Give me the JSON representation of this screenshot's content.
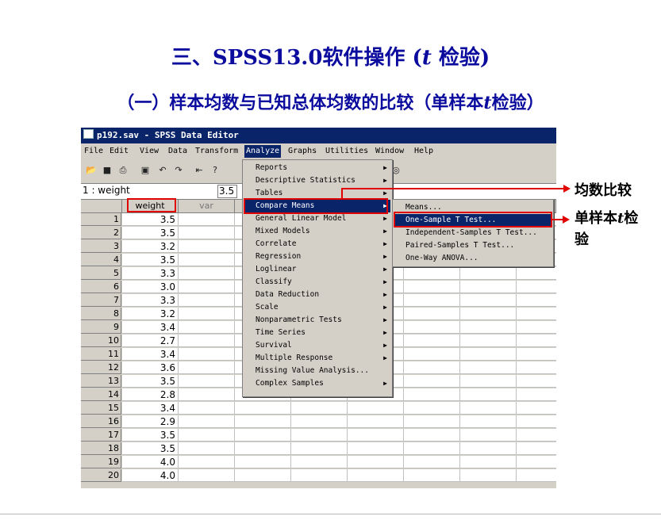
{
  "slide": {
    "title1_pre": "三、SPSS13.0软件操作 (",
    "title1_t": "t",
    "title1_post": " 检验)",
    "title2_pre": "（一）样本均数与已知总体均数的比较（单样本",
    "title2_t": "t",
    "title2_post": "检验）"
  },
  "window": {
    "title": "p192.sav - SPSS Data Editor",
    "menubar": [
      "File",
      "Edit",
      "View",
      "Data",
      "Transform",
      "Analyze",
      "Graphs",
      "Utilities",
      "Window",
      "Help"
    ],
    "active_menu": "Analyze",
    "cell_ref": "1 : weight",
    "cell_value": "3.5"
  },
  "grid": {
    "col_headers": [
      "weight",
      "var"
    ],
    "rows": [
      {
        "n": "1",
        "v": "3.5"
      },
      {
        "n": "2",
        "v": "3.5"
      },
      {
        "n": "3",
        "v": "3.2"
      },
      {
        "n": "4",
        "v": "3.5"
      },
      {
        "n": "5",
        "v": "3.3"
      },
      {
        "n": "6",
        "v": "3.0"
      },
      {
        "n": "7",
        "v": "3.3"
      },
      {
        "n": "8",
        "v": "3.2"
      },
      {
        "n": "9",
        "v": "3.4"
      },
      {
        "n": "10",
        "v": "2.7"
      },
      {
        "n": "11",
        "v": "3.4"
      },
      {
        "n": "12",
        "v": "3.6"
      },
      {
        "n": "13",
        "v": "3.5"
      },
      {
        "n": "14",
        "v": "2.8"
      },
      {
        "n": "15",
        "v": "3.4"
      },
      {
        "n": "16",
        "v": "2.9"
      },
      {
        "n": "17",
        "v": "3.5"
      },
      {
        "n": "18",
        "v": "3.5"
      },
      {
        "n": "19",
        "v": "4.0"
      },
      {
        "n": "20",
        "v": "4.0"
      }
    ]
  },
  "analyze_menu": [
    "Reports",
    "Descriptive Statistics",
    "Tables",
    "Compare Means",
    "General Linear Model",
    "Mixed Models",
    "Correlate",
    "Regression",
    "Loglinear",
    "Classify",
    "Data Reduction",
    "Scale",
    "Nonparametric Tests",
    "Time Series",
    "Survival",
    "Multiple Response",
    "Missing Value Analysis...",
    "Complex Samples"
  ],
  "compare_means_menu": [
    "Means...",
    "One-Sample T Test...",
    "Independent-Samples T Test...",
    "Paired-Samples T Test...",
    "One-Way ANOVA..."
  ],
  "callouts": {
    "compare_means": "均数比较",
    "one_sample_pre": "单样本",
    "one_sample_t": "t",
    "one_sample_mid": "检",
    "one_sample_post": "验"
  }
}
